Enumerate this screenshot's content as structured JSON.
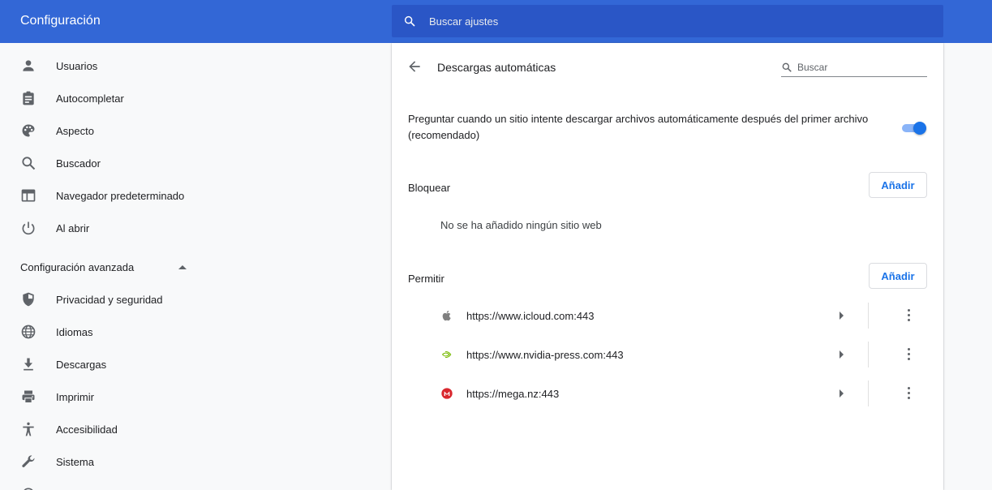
{
  "header": {
    "title": "Configuración",
    "search_placeholder": "Buscar ajustes"
  },
  "sidebar": {
    "items": [
      {
        "label": "Usuarios",
        "icon": "person-icon"
      },
      {
        "label": "Autocompletar",
        "icon": "clipboard-icon"
      },
      {
        "label": "Aspecto",
        "icon": "palette-icon"
      },
      {
        "label": "Buscador",
        "icon": "search-icon"
      },
      {
        "label": "Navegador predeterminado",
        "icon": "browser-icon"
      },
      {
        "label": "Al abrir",
        "icon": "power-icon"
      }
    ],
    "advanced_label": "Configuración avanzada",
    "advanced_items": [
      {
        "label": "Privacidad y seguridad",
        "icon": "shield-icon"
      },
      {
        "label": "Idiomas",
        "icon": "globe-icon"
      },
      {
        "label": "Descargas",
        "icon": "download-icon"
      },
      {
        "label": "Imprimir",
        "icon": "printer-icon"
      },
      {
        "label": "Accesibilidad",
        "icon": "accessibility-icon"
      },
      {
        "label": "Sistema",
        "icon": "wrench-icon"
      }
    ]
  },
  "page": {
    "title": "Descargas automáticas",
    "search_placeholder": "Buscar",
    "preference": "Preguntar cuando un sitio intente descargar archivos automáticamente después del primer archivo (recomendado)",
    "toggle_on": true,
    "accent": "#1a73e8",
    "block": {
      "title": "Bloquear",
      "add_label": "Añadir",
      "empty_message": "No se ha añadido ningún sitio web"
    },
    "allow": {
      "title": "Permitir",
      "add_label": "Añadir",
      "sites": [
        {
          "url": "https://www.icloud.com:443",
          "icon": "apple-icon"
        },
        {
          "url": "https://www.nvidia-press.com:443",
          "icon": "nvidia-icon"
        },
        {
          "url": "https://mega.nz:443",
          "icon": "mega-icon"
        }
      ]
    }
  },
  "colors": {
    "header": "#3367d6",
    "search_bg": "#2a56c6"
  }
}
